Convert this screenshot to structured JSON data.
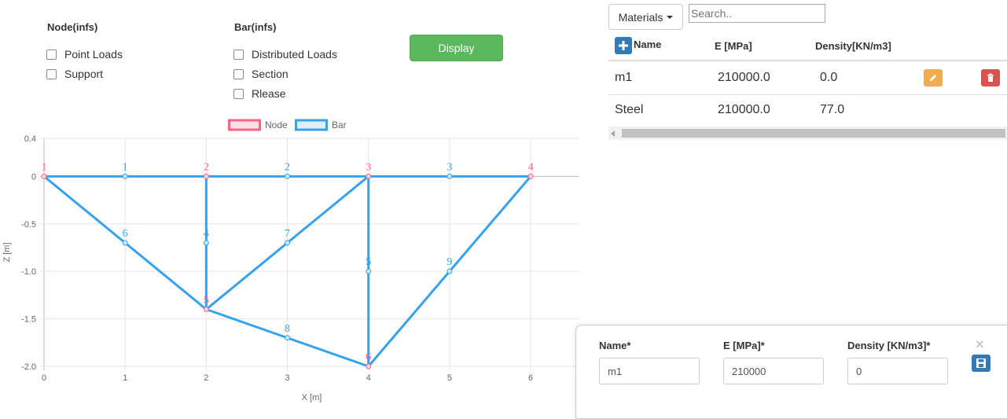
{
  "options": {
    "node_header": "Node(infs)",
    "node_items": [
      "Point Loads",
      "Support"
    ],
    "bar_header": "Bar(infs)",
    "bar_items": [
      "Distributed Loads",
      "Section",
      "Rlease"
    ],
    "display_label": "Display"
  },
  "materials": {
    "dropdown_label": "Materials",
    "search_placeholder": "Search..",
    "columns": [
      "Name",
      "E [MPa]",
      "Density[KN/m3]"
    ],
    "rows": [
      {
        "name": "m1",
        "e": "210000.0",
        "density": "0.0"
      },
      {
        "name": "Steel",
        "e": "210000.0",
        "density": "77.0"
      }
    ],
    "colors": {
      "edit": "#f0ad4e",
      "delete": "#d9534f",
      "add": "#337ab7"
    }
  },
  "form": {
    "name_label": "Name*",
    "e_label": "E [MPa]*",
    "density_label": "Density [KN/m3]*",
    "name_value": "m1",
    "e_value": "210000",
    "density_value": "0",
    "close_symbol": "×"
  },
  "chart_data": {
    "type": "scatter",
    "title": "",
    "xlabel": "X [m]",
    "ylabel": "Z [m]",
    "xlim": [
      0,
      6.6
    ],
    "ylim": [
      -2.0,
      0.4
    ],
    "xticks": [
      0,
      1,
      2,
      3,
      4,
      5,
      6
    ],
    "yticks": [
      0.4,
      0,
      -0.5,
      -1.0,
      -1.5,
      -2.0
    ],
    "ytick_labels": [
      "0.4",
      "0",
      "-0.5",
      "-1.0",
      "-1.5",
      "-2.0"
    ],
    "grid": true,
    "legend_position": "top",
    "series": [
      {
        "name": "Node",
        "color": "#ff6384",
        "points": [
          {
            "x": 0,
            "y": 0,
            "label": "1"
          },
          {
            "x": 2,
            "y": 0,
            "label": "2"
          },
          {
            "x": 4,
            "y": 0,
            "label": "3"
          },
          {
            "x": 6,
            "y": 0,
            "label": "4"
          },
          {
            "x": 2,
            "y": -1.4,
            "label": "5"
          },
          {
            "x": 4,
            "y": -2.0,
            "label": "6"
          }
        ]
      },
      {
        "name": "Bar",
        "color": "#36a2eb",
        "points": [
          {
            "x": 1,
            "y": 0,
            "label": "1"
          },
          {
            "x": 3,
            "y": 0,
            "label": "2"
          },
          {
            "x": 5,
            "y": 0,
            "label": "3"
          },
          {
            "x": 2,
            "y": -0.7,
            "label": "4"
          },
          {
            "x": 4,
            "y": -1.0,
            "label": "5"
          },
          {
            "x": 1,
            "y": -0.7,
            "label": "6"
          },
          {
            "x": 3,
            "y": -0.7,
            "label": "7"
          },
          {
            "x": 3,
            "y": -1.7,
            "label": "8"
          },
          {
            "x": 5,
            "y": -1.0,
            "label": "9"
          }
        ]
      }
    ],
    "bars": [
      [
        [
          0,
          0
        ],
        [
          2,
          0
        ]
      ],
      [
        [
          2,
          0
        ],
        [
          4,
          0
        ]
      ],
      [
        [
          4,
          0
        ],
        [
          6,
          0
        ]
      ],
      [
        [
          2,
          0
        ],
        [
          2,
          -1.4
        ]
      ],
      [
        [
          4,
          0
        ],
        [
          4,
          -2.0
        ]
      ],
      [
        [
          0,
          0
        ],
        [
          2,
          -1.4
        ]
      ],
      [
        [
          4,
          0
        ],
        [
          2,
          -1.4
        ]
      ],
      [
        [
          2,
          -1.4
        ],
        [
          4,
          -2.0
        ]
      ],
      [
        [
          6,
          0
        ],
        [
          4,
          -2.0
        ]
      ]
    ]
  }
}
